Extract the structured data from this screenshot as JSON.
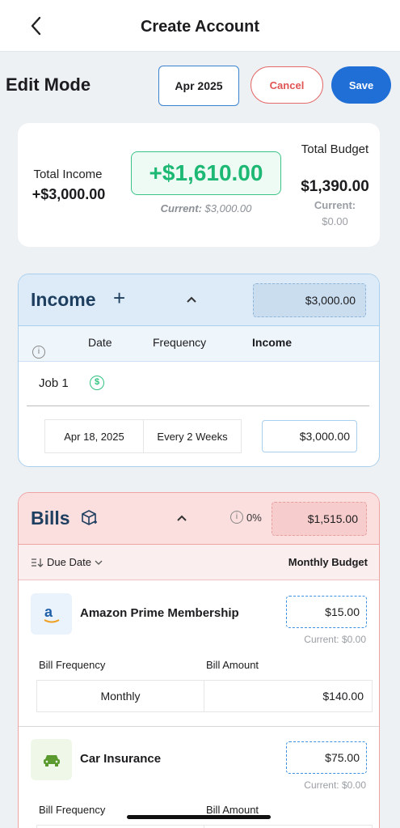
{
  "nav": {
    "title": "Create Account"
  },
  "toolbar": {
    "mode_label": "Edit Mode",
    "month": "Apr 2025",
    "cancel_label": "Cancel",
    "save_label": "Save"
  },
  "summary": {
    "income_label": "Total Income",
    "income_total": "+$3,000.00",
    "net_value": "+$1,610.00",
    "net_current_key": "Current:",
    "net_current_value": "$3,000.00",
    "budget_label": "Total Budget",
    "budget_total": "$1,390.00",
    "budget_current_key": "Current:",
    "budget_current_value": "$0.00",
    "net_color": "#1db874"
  },
  "income": {
    "title": "Income",
    "total": "$3,000.00",
    "columns": {
      "date": "Date",
      "frequency": "Frequency",
      "income": "Income"
    },
    "items": [
      {
        "name": "Job 1",
        "date": "Apr 18, 2025",
        "frequency": "Every 2 Weeks",
        "amount": "$3,000.00"
      }
    ]
  },
  "bills": {
    "title": "Bills",
    "percent": "0%",
    "total": "$1,515.00",
    "sort_label": "Due Date",
    "column_label": "Monthly Budget",
    "freq_label": "Bill Frequency",
    "amount_label": "Bill Amount",
    "items": [
      {
        "name": "Amazon Prime Membership",
        "icon": "amazon-logo-icon",
        "budget": "$15.00",
        "current": "Current: $0.00",
        "frequency": "Monthly",
        "amount": "$140.00"
      },
      {
        "name": "Car Insurance",
        "icon": "car-icon",
        "budget": "$75.00",
        "current": "Current: $0.00"
      }
    ]
  }
}
